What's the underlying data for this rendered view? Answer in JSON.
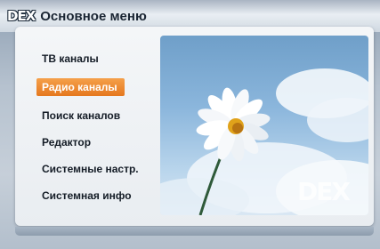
{
  "header": {
    "logo_text": "DEX",
    "title": "Основное меню"
  },
  "menu": {
    "items": [
      {
        "label": "ТВ каналы",
        "selected": false
      },
      {
        "label": "Радио каналы",
        "selected": true
      },
      {
        "label": "Поиск каналов",
        "selected": false
      },
      {
        "label": "Редактор",
        "selected": false
      },
      {
        "label": "Системные настр.",
        "selected": false
      },
      {
        "label": "Системная инфо",
        "selected": false
      }
    ]
  },
  "preview": {
    "logo_text": "DEX",
    "image": "daisy-sky-image"
  },
  "colors": {
    "selection": "#e8821f",
    "panel": "#eef1f4",
    "title_text": "#1a2533"
  }
}
